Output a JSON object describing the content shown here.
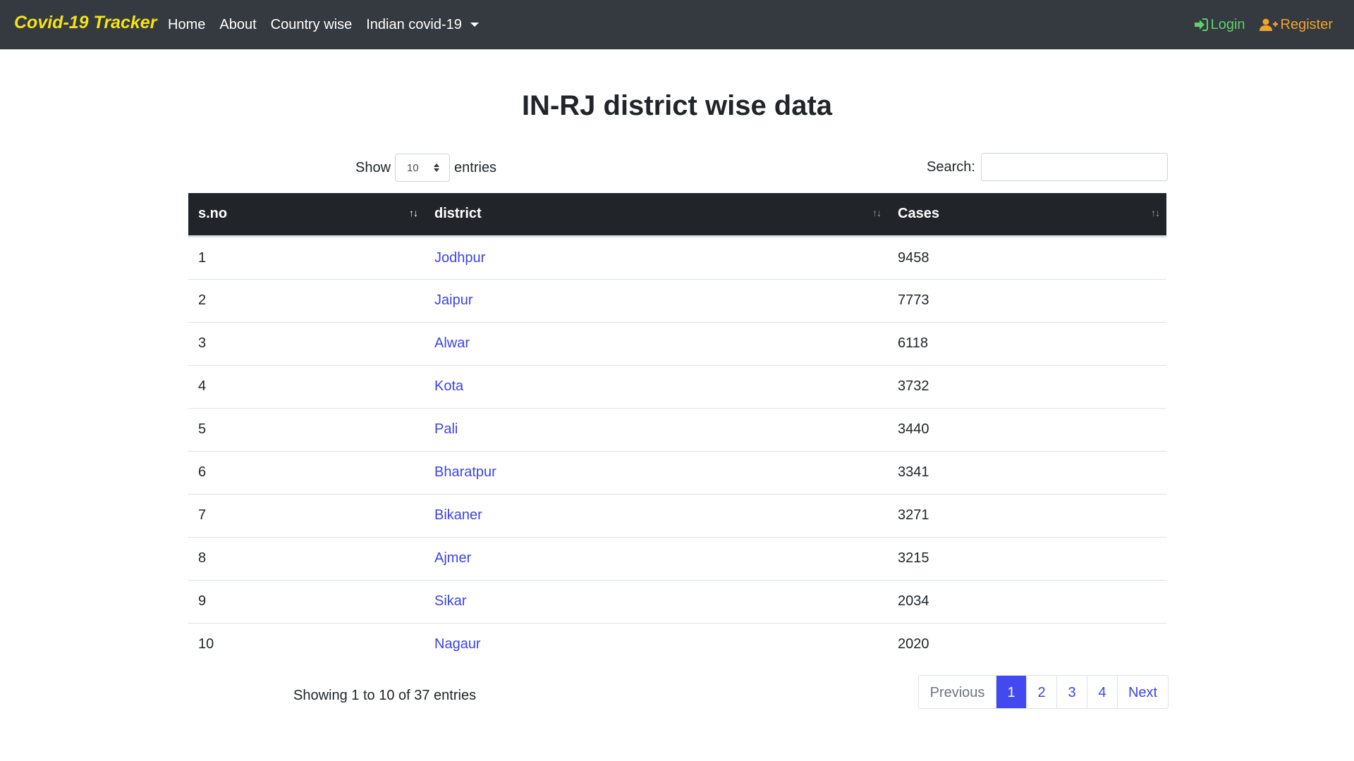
{
  "navbar": {
    "brand": "Covid-19 Tracker",
    "links": [
      "Home",
      "About",
      "Country wise"
    ],
    "dropdown_label": "Indian covid-19",
    "login_label": "Login",
    "register_label": "Register",
    "colors": {
      "brand": "#f5e218",
      "login": "#5fd06a",
      "register": "#f0a32c",
      "background": "#343a40"
    }
  },
  "page": {
    "title": "IN-RJ district wise data"
  },
  "length": {
    "prefix": "Show",
    "selected": "10",
    "suffix": "entries"
  },
  "search": {
    "label": "Search:",
    "value": ""
  },
  "table": {
    "headers": [
      "s.no",
      "district",
      "Cases"
    ],
    "rows": [
      {
        "sno": "1",
        "district": "Jodhpur",
        "cases": "9458"
      },
      {
        "sno": "2",
        "district": "Jaipur",
        "cases": "7773"
      },
      {
        "sno": "3",
        "district": "Alwar",
        "cases": "6118"
      },
      {
        "sno": "4",
        "district": "Kota",
        "cases": "3732"
      },
      {
        "sno": "5",
        "district": "Pali",
        "cases": "3440"
      },
      {
        "sno": "6",
        "district": "Bharatpur",
        "cases": "3341"
      },
      {
        "sno": "7",
        "district": "Bikaner",
        "cases": "3271"
      },
      {
        "sno": "8",
        "district": "Ajmer",
        "cases": "3215"
      },
      {
        "sno": "9",
        "district": "Sikar",
        "cases": "2034"
      },
      {
        "sno": "10",
        "district": "Nagaur",
        "cases": "2020"
      }
    ]
  },
  "footer": {
    "info": "Showing 1 to 10 of 37 entries",
    "pagination": {
      "previous": "Previous",
      "pages": [
        "1",
        "2",
        "3",
        "4"
      ],
      "next": "Next",
      "active_page": "1"
    }
  }
}
